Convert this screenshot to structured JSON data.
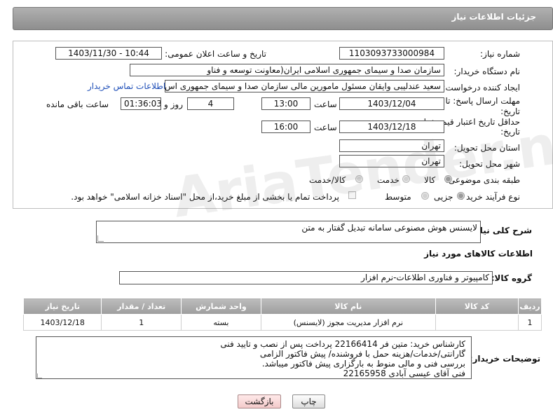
{
  "header": {
    "title": "جزئیات اطلاعات نیاز"
  },
  "form": {
    "need_number_label": "شماره نیاز:",
    "need_number": "1103093733000984",
    "announce_label": "تاریخ و ساعت اعلان عمومی:",
    "announce_value": "1403/11/30 - 10:44",
    "buyer_org_label": "نام دستگاه خریدار:",
    "buyer_org": "سازمان صدا و سیمای جمهوری اسلامی ایران(معاونت توسعه و فناو",
    "creator_label": "ایجاد کننده درخواست:",
    "creator": "سعید عندلیبی وایقان مسئول مامورین مالی  سازمان صدا و سیمای جمهوری اس",
    "contact_link": "اطلاعات تماس خریدار",
    "reply_deadline_label_1": "مهلت ارسال پاسخ: تا",
    "reply_deadline_label_2": "تاریخ:",
    "reply_date": "1403/12/04",
    "time_label": "ساعت",
    "reply_time": "13:00",
    "days_value": "4",
    "days_label": "روز و",
    "remaining_time": "01:36:03",
    "remaining_label": "ساعت باقی مانده",
    "price_validity_label_1": "حداقل تاریخ اعتبار قیمت: تا",
    "price_validity_label_2": "تاریخ:",
    "validity_date": "1403/12/18",
    "validity_time": "16:00",
    "province_label": "استان محل تحویل:",
    "province": "تهران",
    "city_label": "شهر محل تحویل:",
    "city": "تهران",
    "category_label": "طبقه بندی موضوعی:",
    "category_options": [
      "کالا",
      "خدمت",
      "کالا/خدمت"
    ],
    "process_label": "نوع فرآیند خرید :",
    "process_options": [
      "جزیی",
      "متوسط"
    ],
    "payment_note": "پرداخت تمام یا بخشی از مبلغ خرید،از محل \"اسناد خزانه اسلامی\" خواهد بود."
  },
  "description": {
    "label": "شرح کلی نیاز:",
    "value": "لایسنس هوش مصنوعی سامانه تبدیل گفتار به متن"
  },
  "goods_section": {
    "title": "اطلاعات کالاهای مورد نیاز",
    "group_label": "گروه کالا:",
    "group_value": "کامپیوتر و فناوری اطلاعات-نرم افزار"
  },
  "table": {
    "headers": [
      "ردیف",
      "کد کالا",
      "نام کالا",
      "واحد شمارش",
      "تعداد / مقدار",
      "تاریخ نیاز"
    ],
    "rows": [
      {
        "row": "1",
        "code": "",
        "name": "نرم افزار مدیریت مجوز (لایسنس)",
        "unit": "بسته",
        "qty": "1",
        "date": "1403/12/18"
      }
    ]
  },
  "buyer_notes": {
    "label": "توضیحات خریدار:",
    "lines": [
      "کارشناس خرید: متین فر 22166414    پرداخت پس از نصب و تایید فنی",
      "گارانتی/خدمات/هزینه حمل با فروشنده/ پیش فاکتور الزامی",
      "بررسی فنی و مالی منوط به بارگزاری پیش فاکتور میباشد.",
      "فنی آقای عیسی آبادی 22165958"
    ]
  },
  "buttons": {
    "print": "چاپ",
    "back": "بازگشت"
  },
  "watermark": "AriaTender.neT"
}
